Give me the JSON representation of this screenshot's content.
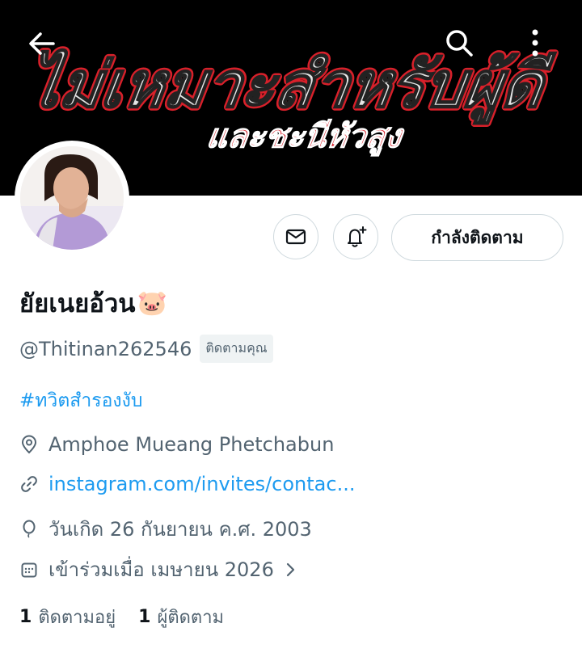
{
  "banner": {
    "headline": "ไม่เหมาะสำหรับผู้ดี",
    "subline": "และชะนีหัวสูง"
  },
  "icons": {
    "back": "arrow-left-icon",
    "search": "search-icon",
    "more": "more-vertical-icon",
    "message": "envelope-icon",
    "notify": "bell-plus-icon",
    "location": "location-pin-icon",
    "link": "link-icon",
    "birthday": "balloon-icon",
    "joined": "calendar-icon",
    "chevron": "chevron-right-icon"
  },
  "profile": {
    "display_name": "ยัยเนยอ้วน",
    "name_emoji": "🐷",
    "handle": "@Thitinan262546",
    "follows_you": "ติดตามคุณ",
    "follow_button": "กำลังติดตาม",
    "bio_hashtag": "#ทวิตสำรองงับ",
    "location": "Amphoe Mueang Phetchabun",
    "link": "instagram.com/invites/contac...",
    "birthday": "วันเกิด 26 กันยายน ค.ศ. 2003",
    "joined": "เข้าร่วมเมื่อ เมษายน 2026"
  },
  "stats": {
    "following_count": "1",
    "following_label": "ติดตามอยู่",
    "followers_count": "1",
    "followers_label": "ผู้ติดตาม"
  },
  "colors": {
    "accent": "#1d9bf0",
    "secondary_text": "#536471",
    "banner_red": "#d8202a"
  }
}
